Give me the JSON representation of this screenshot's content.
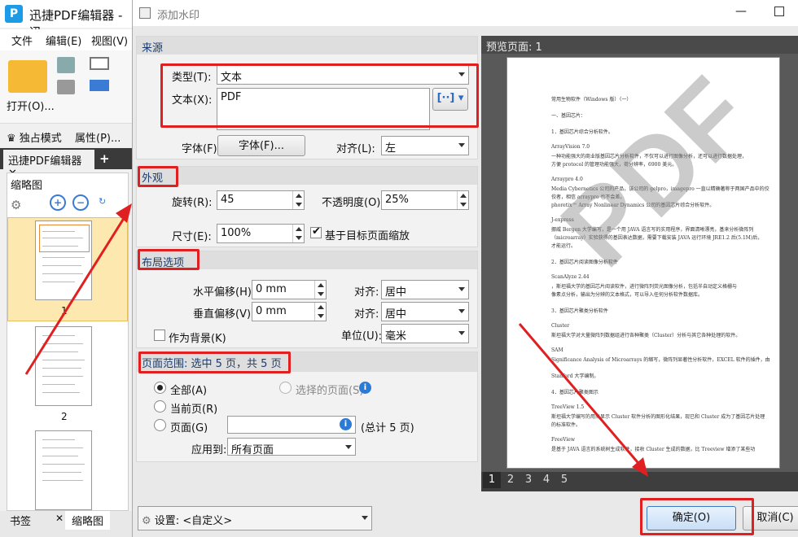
{
  "app": {
    "title": "迅捷PDF编辑器 - 迅",
    "menus": [
      "文件",
      "编辑(E)",
      "视图(V)"
    ],
    "open_label": "打开(O)...",
    "exclusive_mode": "独占模式",
    "properties": "属性(P)...",
    "doc_tab": "迅捷PDF编辑器",
    "thumbnail_panel": "缩略图",
    "page_labels": [
      "1",
      "2"
    ],
    "bottom_tabs": [
      "书签",
      "缩略图"
    ]
  },
  "dialog": {
    "title": "添加水印",
    "source": {
      "header": "来源",
      "type_label": "类型(T):",
      "type_value": "文本",
      "text_label": "文本(X):",
      "text_value": "PDF",
      "insert_btn": "[··]",
      "font_label": "字体(F):",
      "font_btn": "字体(F)...",
      "align_label": "对齐(L):",
      "align_value": "左"
    },
    "appearance": {
      "header": "外观",
      "rotate_label": "旋转(R):",
      "rotate_value": "45",
      "opacity_label": "不透明度(O):",
      "opacity_value": "25%",
      "size_label": "尺寸(E):",
      "size_value": "100%",
      "scale_label": "基于目标页面缩放",
      "scale_checked": true
    },
    "layout": {
      "header": "布局选项",
      "h_offset_label": "水平偏移(H):",
      "h_offset_value": "0 mm",
      "h_align_label": "对齐:",
      "h_align_value": "居中",
      "v_offset_label": "垂直偏移(V):",
      "v_offset_value": "0 mm",
      "v_align_label": "对齐:",
      "v_align_value": "居中",
      "as_bg_label": "作为背景(K)",
      "unit_label": "单位(U):",
      "unit_value": "毫米"
    },
    "page_range": {
      "header": "页面范围: 选中 5 页，共 5 页",
      "all": "全部(A)",
      "selected": "选择的页面(S)",
      "current": "当前页(R)",
      "pages": "页面(G)",
      "total": "(总计 5 页)",
      "apply_label": "应用到:",
      "apply_value": "所有页面"
    },
    "settings_label": "设置:",
    "settings_value": "<自定义>",
    "preview_label": "预览页面: 1",
    "page_numbers": [
      "1",
      "2",
      "3",
      "4",
      "5"
    ],
    "watermark_text": "PDF",
    "ok": "确定(O)",
    "cancel": "取消(C)"
  },
  "preview_doc": [
    "常用生物软件（Windows 版）（一）",
    "一、基因芯片：",
    "1．基因芯片综合分析软件。",
    "ArrayVision 7.0",
    "一种功能强大的商业版基因芯片分析软件，不仅可以进行图像分析，还可以进行数据处理，",
    "方便 protocol 的管理功能强大，荷分辨率，6900 美元。",
    "Arraypro 4.0",
    "Media Cybernetics 公司的产品，该公司的 gelpro，imagepro 一直以精确著称于两国产品中的佼",
    "佼者，相信 arraypro 也不会差。",
    "phoretix™ Array Nonlinear Dynamics 公司的基因芯片综合分析软件。",
    "J-express",
    "挪威 Bergen 大学编写，是一个用 JAVA 语言写的实用程序，界面清晰漂亮，基来分析微阵列",
    "（microarray）实验获得的基因表达数据，需要下载安装 JAVA 运行环境 JRE1.2 后(5.1M)后，",
    "才能运行。",
    "2．基因芯片阅读图像分析软件",
    "ScanAlyze 2.44",
    "，斯坦福大学的基因芯片阅读软件，进行微阵列荧光图像分析，包括半自动定义格栅与",
    "像素点分析，输出为分辨的文本格式，可以导入任何分析软件数据库。",
    "3．基因芯片聚类分析软件",
    "Cluster",
    "斯坦福大学对大量微阵列数据组进行各种聚类（Cluster）分析与其它各种处理的软件。",
    "SAM",
    "Significance Analysis of Microarrays 的缩写，微阵列显著性分析软件，EXCEL 软件的插件，由",
    "Stanford 大学编制。",
    "4．基因芯片聚类图示",
    "TreeView 1.5",
    "斯坦福大学编写的用来显示 Cluster 软件分析的图形化结果，现已和 Cluster 成为了基因芯片处理",
    "的标准软件。",
    "FreeView",
    "是基于 JAVA 语言的系统树生成软件，接收 Cluster 生成的数据，比 Treeview 增添了某些功"
  ]
}
